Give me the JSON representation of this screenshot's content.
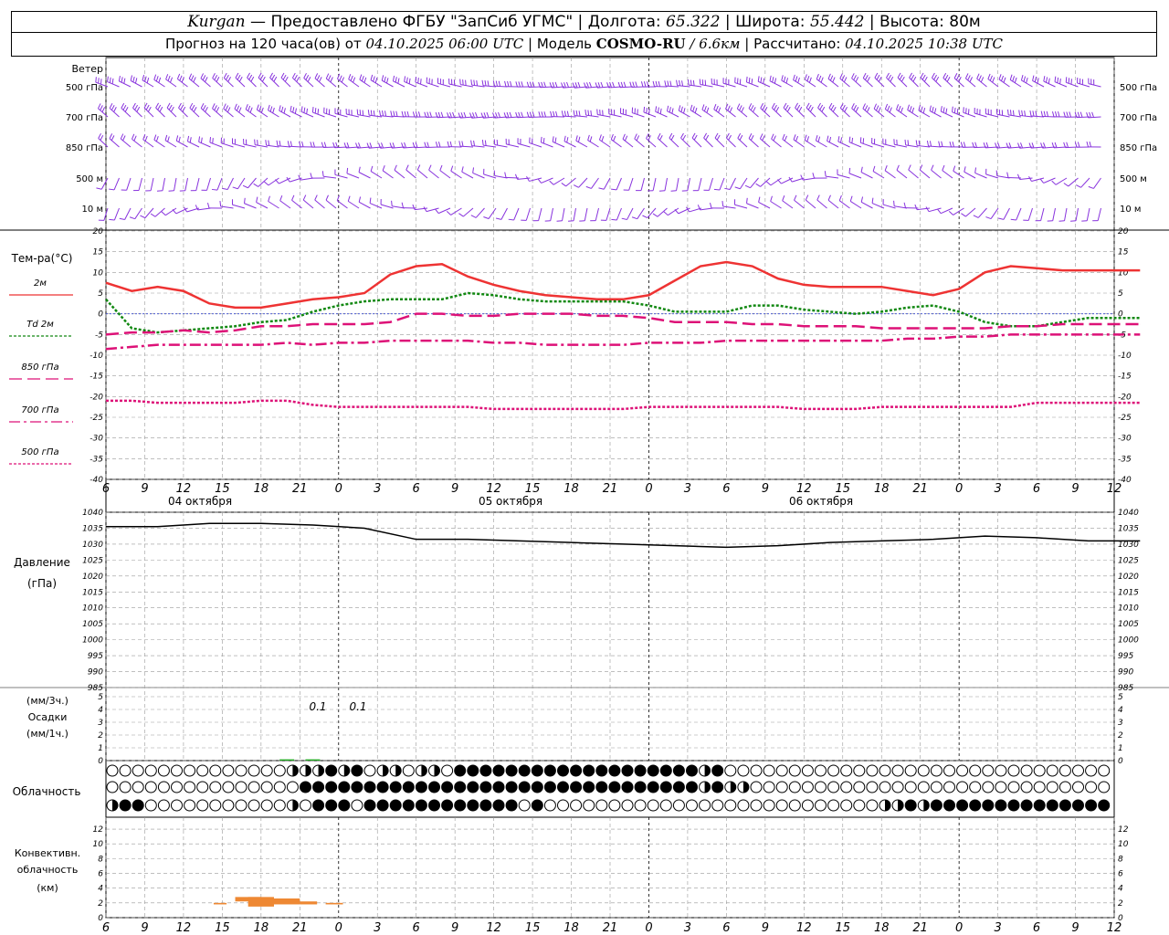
{
  "header": {
    "city": "Kurgan",
    "dash": "—",
    "provider": "Предоставлено ФГБУ \"ЗапСиб УГМС\"",
    "lon_label": "Долгота:",
    "lon": "65.322",
    "lat_label": "Широта:",
    "lat": "55.442",
    "alt_label": "Высота:",
    "alt": "80м",
    "forecast_label": "Прогноз на 120 часа(ов) от",
    "forecast_start": "04.10.2025 06:00 UTC",
    "model_label": "Модель",
    "model": "COSMO-RU",
    "resolution": "/ 6.6км",
    "calc_label": "Рассчитано:",
    "calc_time": "04.10.2025 10:38 UTC"
  },
  "wind_panel": {
    "title": "Ветер",
    "levels": [
      "500 гПа",
      "700 гПа",
      "850 гПа",
      "500 м",
      "10  м"
    ]
  },
  "temp_panel": {
    "title": "Тем-ра(°C)",
    "legend": [
      {
        "label": "2м",
        "color": "#ee3333",
        "dash": ""
      },
      {
        "label": "Td  2м",
        "color": "#118811",
        "dash": "3,2"
      },
      {
        "label": "850 гПа",
        "color": "#dd1177",
        "dash": "14,6"
      },
      {
        "label": "700 гПа",
        "color": "#dd1177",
        "dash": "12,4,3,4"
      },
      {
        "label": "500 гПа",
        "color": "#dd1177",
        "dash": "3,2"
      }
    ],
    "yticks": [
      "20",
      "15",
      "10",
      "5",
      "0",
      "-5",
      "-10",
      "-15",
      "-20",
      "-25",
      "-30",
      "-35",
      "-40"
    ]
  },
  "time_axis": {
    "ticks": [
      "6",
      "9",
      "12",
      "15",
      "18",
      "21",
      "0",
      "3",
      "6",
      "9",
      "12",
      "15",
      "18",
      "21",
      "0",
      "3",
      "6",
      "9",
      "12",
      "15",
      "18",
      "21",
      "0",
      "3",
      "6",
      "9",
      "12"
    ],
    "dates": [
      "04 октября",
      "05 октября",
      "06 октября"
    ]
  },
  "pressure_panel": {
    "title": "Давление",
    "unit": "(гПа)",
    "yticks": [
      "1040",
      "1035",
      "1030",
      "1025",
      "1020",
      "1015",
      "1010",
      "1005",
      "1000",
      "995",
      "990",
      "985"
    ]
  },
  "precip_panel": {
    "unit_top": "(мм/3ч.)",
    "title": "Осадки",
    "unit_bottom": "(мм/1ч.)",
    "yticks": [
      "5",
      "4",
      "3",
      "2",
      "1",
      "0"
    ],
    "annotations": [
      "0.1",
      "0.1"
    ]
  },
  "cloud_panel": {
    "title": "Облачность"
  },
  "conv_panel": {
    "title_1": "Конвективн.",
    "title_2": "облачность",
    "unit": "(км)",
    "yticks": [
      "12",
      "10",
      "8",
      "6",
      "4",
      "2",
      "0"
    ]
  },
  "chart_data": [
    {
      "type": "line",
      "panel": "temperature",
      "x_hours": [
        0,
        3,
        6,
        9,
        12,
        15,
        18,
        21,
        24,
        27,
        30,
        33,
        36,
        39,
        42,
        45,
        48,
        51,
        54,
        57,
        60,
        63,
        66,
        69,
        72,
        75,
        78,
        81,
        84,
        87,
        90,
        93,
        96,
        99,
        102,
        105,
        108,
        111,
        114,
        117,
        120
      ],
      "ylim": [
        -40,
        20
      ],
      "series": [
        {
          "name": "2м",
          "values": [
            7.5,
            5.5,
            6.5,
            5.5,
            2.5,
            1.5,
            1.5,
            2.5,
            3.5,
            4.0,
            5.0,
            9.5,
            11.5,
            12.0,
            9.0,
            7.0,
            5.5,
            4.5,
            4.0,
            3.5,
            3.5,
            4.5,
            8.0,
            11.5,
            12.5,
            11.5,
            8.5,
            7.0,
            6.5,
            6.5,
            6.5,
            5.5,
            4.5,
            6.0,
            10.0,
            11.5,
            11.0,
            10.5,
            10.5,
            10.5,
            10.5
          ]
        },
        {
          "name": "Td  2м",
          "values": [
            3.5,
            -3.5,
            -4.5,
            -4.0,
            -3.5,
            -3.0,
            -2.0,
            -1.5,
            0.5,
            2.0,
            3.0,
            3.5,
            3.5,
            3.5,
            5.0,
            4.5,
            3.5,
            3.0,
            3.0,
            3.0,
            3.0,
            2.0,
            0.5,
            0.5,
            0.5,
            2.0,
            2.0,
            1.0,
            0.5,
            0.0,
            0.5,
            1.5,
            2.0,
            0.5,
            -2.0,
            -3.0,
            -3.0,
            -2.0,
            -1.0,
            -1.0,
            -1.0
          ]
        },
        {
          "name": "850 гПа",
          "values": [
            -5.0,
            -4.5,
            -4.5,
            -4.0,
            -4.5,
            -4.0,
            -3.0,
            -3.0,
            -2.5,
            -2.5,
            -2.5,
            -2.0,
            0.0,
            0.0,
            -0.5,
            -0.5,
            0.0,
            0.0,
            0.0,
            -0.5,
            -0.5,
            -1.0,
            -2.0,
            -2.0,
            -2.0,
            -2.5,
            -2.5,
            -3.0,
            -3.0,
            -3.0,
            -3.5,
            -3.5,
            -3.5,
            -3.5,
            -3.5,
            -3.0,
            -3.0,
            -2.5,
            -2.5,
            -2.5,
            -2.5
          ]
        },
        {
          "name": "700 гПа",
          "values": [
            -8.5,
            -8.0,
            -7.5,
            -7.5,
            -7.5,
            -7.5,
            -7.5,
            -7.0,
            -7.5,
            -7.0,
            -7.0,
            -6.5,
            -6.5,
            -6.5,
            -6.5,
            -7.0,
            -7.0,
            -7.5,
            -7.5,
            -7.5,
            -7.5,
            -7.0,
            -7.0,
            -7.0,
            -6.5,
            -6.5,
            -6.5,
            -6.5,
            -6.5,
            -6.5,
            -6.5,
            -6.0,
            -6.0,
            -5.5,
            -5.5,
            -5.0,
            -5.0,
            -5.0,
            -5.0,
            -5.0,
            -5.0
          ]
        },
        {
          "name": "500 гПа",
          "values": [
            -21.0,
            -21.0,
            -21.5,
            -21.5,
            -21.5,
            -21.5,
            -21.0,
            -21.0,
            -22.0,
            -22.5,
            -22.5,
            -22.5,
            -22.5,
            -22.5,
            -22.5,
            -23.0,
            -23.0,
            -23.0,
            -23.0,
            -23.0,
            -23.0,
            -22.5,
            -22.5,
            -22.5,
            -22.5,
            -22.5,
            -22.5,
            -23.0,
            -23.0,
            -23.0,
            -22.5,
            -22.5,
            -22.5,
            -22.5,
            -22.5,
            -22.5,
            -21.5,
            -21.5,
            -21.5,
            -21.5,
            -21.5
          ]
        }
      ]
    },
    {
      "type": "line",
      "panel": "pressure",
      "x_hours": [
        0,
        6,
        12,
        18,
        24,
        30,
        36,
        42,
        48,
        54,
        60,
        66,
        72,
        78,
        84,
        90,
        96,
        102,
        108,
        114,
        120
      ],
      "ylim": [
        985,
        1040
      ],
      "series": [
        {
          "values": [
            1035.5,
            1035.5,
            1036.5,
            1036.5,
            1036.0,
            1035.0,
            1031.5,
            1031.5,
            1031.0,
            1030.5,
            1030.0,
            1029.5,
            1029.0,
            1029.5,
            1030.5,
            1031.0,
            1031.5,
            1032.5,
            1032.0,
            1031.0,
            1031.0
          ]
        }
      ]
    },
    {
      "type": "bar",
      "panel": "precipitation",
      "x_hours": [
        21,
        24
      ],
      "ylim": [
        0,
        5
      ],
      "values": [
        0.1,
        0.1
      ],
      "color": "#22aa22"
    },
    {
      "type": "table",
      "panel": "cloud_cover",
      "columns_per_hour": 1,
      "rows": [
        "000000000000001112120110110222222222222222222212000000000000000000000000000000000000000000000000000000000000000000000",
        "000000000000000222222222222222222222222222222212110000000000000000000000000000000000000000000000000000000000000000000",
        "122000000000001022202222222222220200000000000000000000000000112122222222222222222222222200000000000000000000000000000"
      ],
      "legend_values": {
        "0": "clear",
        "1": "partly",
        "2": "overcast"
      }
    },
    {
      "type": "bar",
      "panel": "convective_cloud",
      "ylim": [
        0,
        13
      ],
      "color": "#ee8833",
      "segments": [
        {
          "from_hour": 12.5,
          "to_hour": 14.0,
          "bottom_km": 1.8,
          "top_km": 2.0
        },
        {
          "from_hour": 15.0,
          "to_hour": 18.0,
          "bottom_km": 2.2,
          "top_km": 2.8
        },
        {
          "from_hour": 16.5,
          "to_hour": 19.5,
          "bottom_km": 1.5,
          "top_km": 2.8
        },
        {
          "from_hour": 19.5,
          "to_hour": 22.5,
          "bottom_km": 1.8,
          "top_km": 2.6
        },
        {
          "from_hour": 22.5,
          "to_hour": 24.5,
          "bottom_km": 1.8,
          "top_km": 2.2
        },
        {
          "from_hour": 25.5,
          "to_hour": 27.5,
          "bottom_km": 1.8,
          "top_km": 2.0
        }
      ]
    }
  ]
}
